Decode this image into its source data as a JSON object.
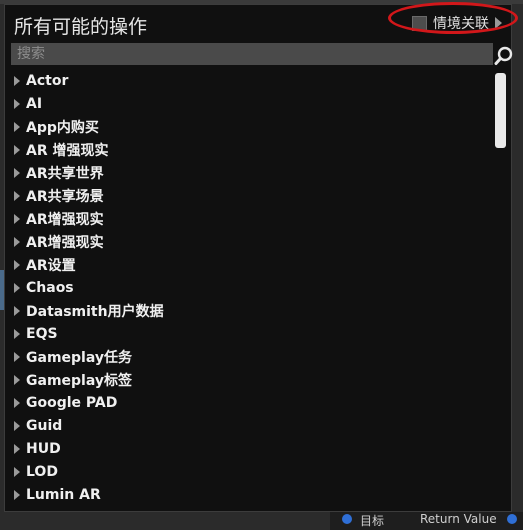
{
  "panel": {
    "title": "所有可能的操作",
    "context_toggle": {
      "label": "情境关联",
      "checked": false
    }
  },
  "search": {
    "placeholder": "搜索",
    "value": ""
  },
  "background": {
    "bottom_left_label": "目标",
    "bottom_right_label": "Return Value"
  },
  "colors": {
    "highlight_ring": "#d2171a",
    "panel_bg": "#101010",
    "search_bg": "#4a4a4a"
  },
  "categories": [
    "Actor",
    "AI",
    "App内购买",
    "AR 增强现实",
    "AR共享世界",
    "AR共享场景",
    "AR增强现实",
    "AR增强现实",
    "AR设置",
    "Chaos",
    "Datasmith用户数据",
    "EQS",
    "Gameplay任务",
    "Gameplay标签",
    "Google PAD",
    "Guid",
    "HUD",
    "LOD",
    "Lumin AR"
  ]
}
